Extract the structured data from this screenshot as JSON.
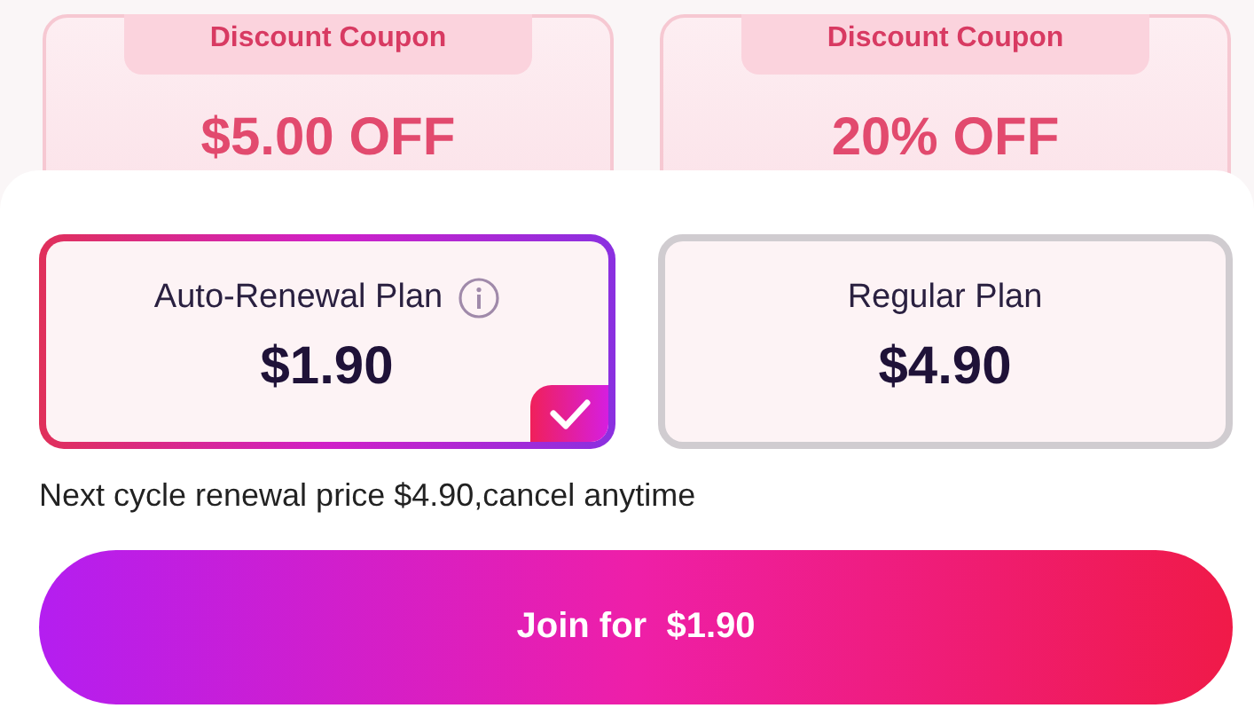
{
  "coupons": [
    {
      "title": "Discount Coupon",
      "value": "$5.00 OFF"
    },
    {
      "title": "Discount Coupon",
      "value": "20% OFF"
    }
  ],
  "plans": [
    {
      "name": "Auto-Renewal Plan",
      "info": true,
      "price": "$1.90",
      "selected": true
    },
    {
      "name": "Regular Plan",
      "info": false,
      "price": "$4.90",
      "selected": false
    }
  ],
  "note": "Next cycle renewal price $4.90,cancel anytime",
  "join_button": "Join for  $1.90"
}
